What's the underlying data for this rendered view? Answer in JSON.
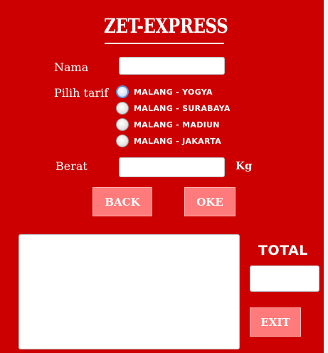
{
  "form": {
    "title": "ZET-EXPRESS",
    "nama_label": "Nama",
    "nama_value": "",
    "tarif_label": "Pilih tarif",
    "tarif_options": [
      "MALANG - YOGYA",
      "MALANG - SURABAYA",
      "MALANG - MADIUN",
      "MALANG - JAKARTA"
    ],
    "berat_label": "Berat",
    "berat_value": "",
    "unit_label": "Kg",
    "back_label": "BACK",
    "oke_label": "OKE",
    "output_text": "",
    "total_label": "TOTAL",
    "total_value": "",
    "exit_label": "EXIT"
  },
  "colors": {
    "background": "#cc0000",
    "button": "#ff7b7b",
    "text": "#ffffff"
  }
}
